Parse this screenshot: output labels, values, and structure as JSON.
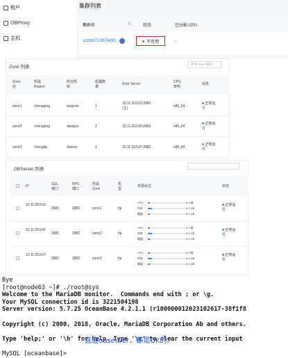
{
  "sidebar": {
    "items": [
      {
        "label": "租户",
        "icon": "tenant-icon"
      },
      {
        "label": "OBProxy",
        "icon": "proxy-icon"
      },
      {
        "label": "主机",
        "icon": "host-icon"
      }
    ]
  },
  "cluster_list": {
    "title": "集群列表",
    "headers": [
      "集群名",
      "状态",
      "已分配 CPU"
    ],
    "row": {
      "name": "ozzbt1713876430",
      "status": "不可用",
      "cpu": "-"
    }
  },
  "zone_list": {
    "title": "Zone 列表",
    "add_button": "新增 Zone 按钮",
    "headers": [
      "Zone 名",
      "所属 Region",
      "所在机房",
      "机器数量",
      "Root Server",
      "CPU 架构",
      "状态"
    ],
    "rows": [
      {
        "zone": "zone1",
        "region": "chongqing",
        "idc": "langcao",
        "count": "1",
        "root": "10.11.253.63:2882",
        "root_note": "(主)",
        "arch": "x86_64",
        "status": "正常运行"
      },
      {
        "zone": "zone2",
        "region": "chongqing",
        "idc": "daxigou",
        "count": "1",
        "root": "10.11.253.65:2882",
        "root_note": "",
        "arch": "x86_64",
        "status": "正常运行"
      },
      {
        "zone": "zone3",
        "region": "chengdu",
        "idc": "dianxin",
        "count": "1",
        "root": "10.11.253.67:2882",
        "root_note": "",
        "arch": "x86_64",
        "status": "正常运行"
      }
    ]
  },
  "observer_list": {
    "title": "OBServer 列表",
    "search_placeholder": "",
    "headers": [
      "IP",
      "SQL 端口",
      "RPC 端口",
      "所属 Zone",
      "机型",
      "资源水位",
      "状态"
    ],
    "resource_labels": [
      "CPU",
      "内存",
      "磁盘"
    ],
    "rows": [
      {
        "ip": "10.11.253.63",
        "sql": "2881",
        "rpc": "2882",
        "zone": "zone1",
        "type": "hp",
        "res": [
          "0.0 核",
          "0.0 GB",
          "0.0 GB"
        ],
        "levels": [
          0.05,
          0.1,
          0.05
        ],
        "status": "正常运行"
      },
      {
        "ip": "10.11.253.65",
        "sql": "2881",
        "rpc": "2882",
        "zone": "zone2",
        "type": "hp",
        "res": [
          "0.0 核",
          "0.0 GB",
          "0.0 GB"
        ],
        "levels": [
          0.05,
          0.1,
          0.05
        ],
        "status": "正常运行"
      },
      {
        "ip": "10.11.253.67",
        "sql": "2881",
        "rpc": "2882",
        "zone": "zone3",
        "type": "hp",
        "res": [
          "0.0 核",
          "0.0 GB",
          "0.0 GB"
        ],
        "levels": [
          0.05,
          0.1,
          0.05
        ],
        "status": "正常运行"
      }
    ]
  },
  "terminal": {
    "lines": [
      "Bye",
      "[root@node63 ~]# ./root@sys",
      "Welcome to the MariaDB monitor.  Commands end with ; or \\g.",
      "Your MySQL connection id is 3221504198",
      "Server version: 5.7.25 OceanBase 4.2.1.1 (r100000012023102617-38f1f8",
      "",
      "Copyright (c) 2000, 2018, Oracle, MariaDB Corporation Ab and others.",
      "",
      "Type 'help;' or '\\h' for help. Type '\\c' to clear the current input",
      "",
      "MySQL [oceanbase]>"
    ],
    "overlay_text": "直连observer，都是OK的。"
  },
  "colors": {
    "link": "#1677ff",
    "error": "#e02020",
    "ok": "#2db84d"
  }
}
